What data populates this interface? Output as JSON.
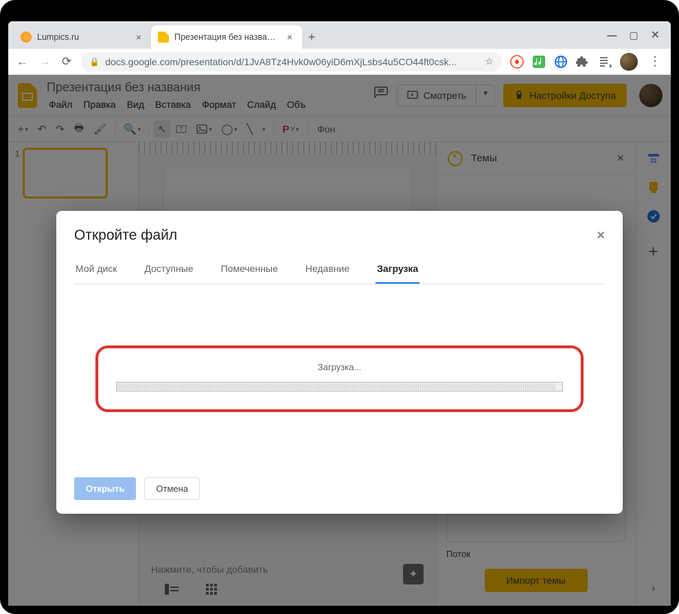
{
  "browser": {
    "tabs": [
      {
        "title": "Lumpics.ru",
        "active": false
      },
      {
        "title": "Презентация без названия - Go",
        "active": true
      }
    ],
    "url": "docs.google.com/presentation/d/1JvA8Tz4Hvk0w06yiD6mXjLsbs4u5CO44ft0csk..."
  },
  "app": {
    "docTitle": "Презентация без названия",
    "menus": [
      "Файл",
      "Правка",
      "Вид",
      "Вставка",
      "Формат",
      "Слайд",
      "Объ"
    ],
    "presentLabel": "Смотреть",
    "shareLabel": "Настройки Доступа",
    "bgLabel": "Фон",
    "ryLabel": "Р"
  },
  "thumbs": {
    "slide1": "1"
  },
  "notes": {
    "placeholder": "Нажмите, чтобы добавить"
  },
  "themes": {
    "title": "Темы",
    "theme1": "Поток",
    "importLabel": "Импорт темы"
  },
  "modal": {
    "title": "Откройте файл",
    "tabs": {
      "mydrive": "Мой диск",
      "shared": "Доступные",
      "starred": "Помеченные",
      "recent": "Недавние",
      "upload": "Загрузка"
    },
    "loadingLabel": "Загрузка...",
    "openBtn": "Открыть",
    "cancelBtn": "Отмена"
  }
}
